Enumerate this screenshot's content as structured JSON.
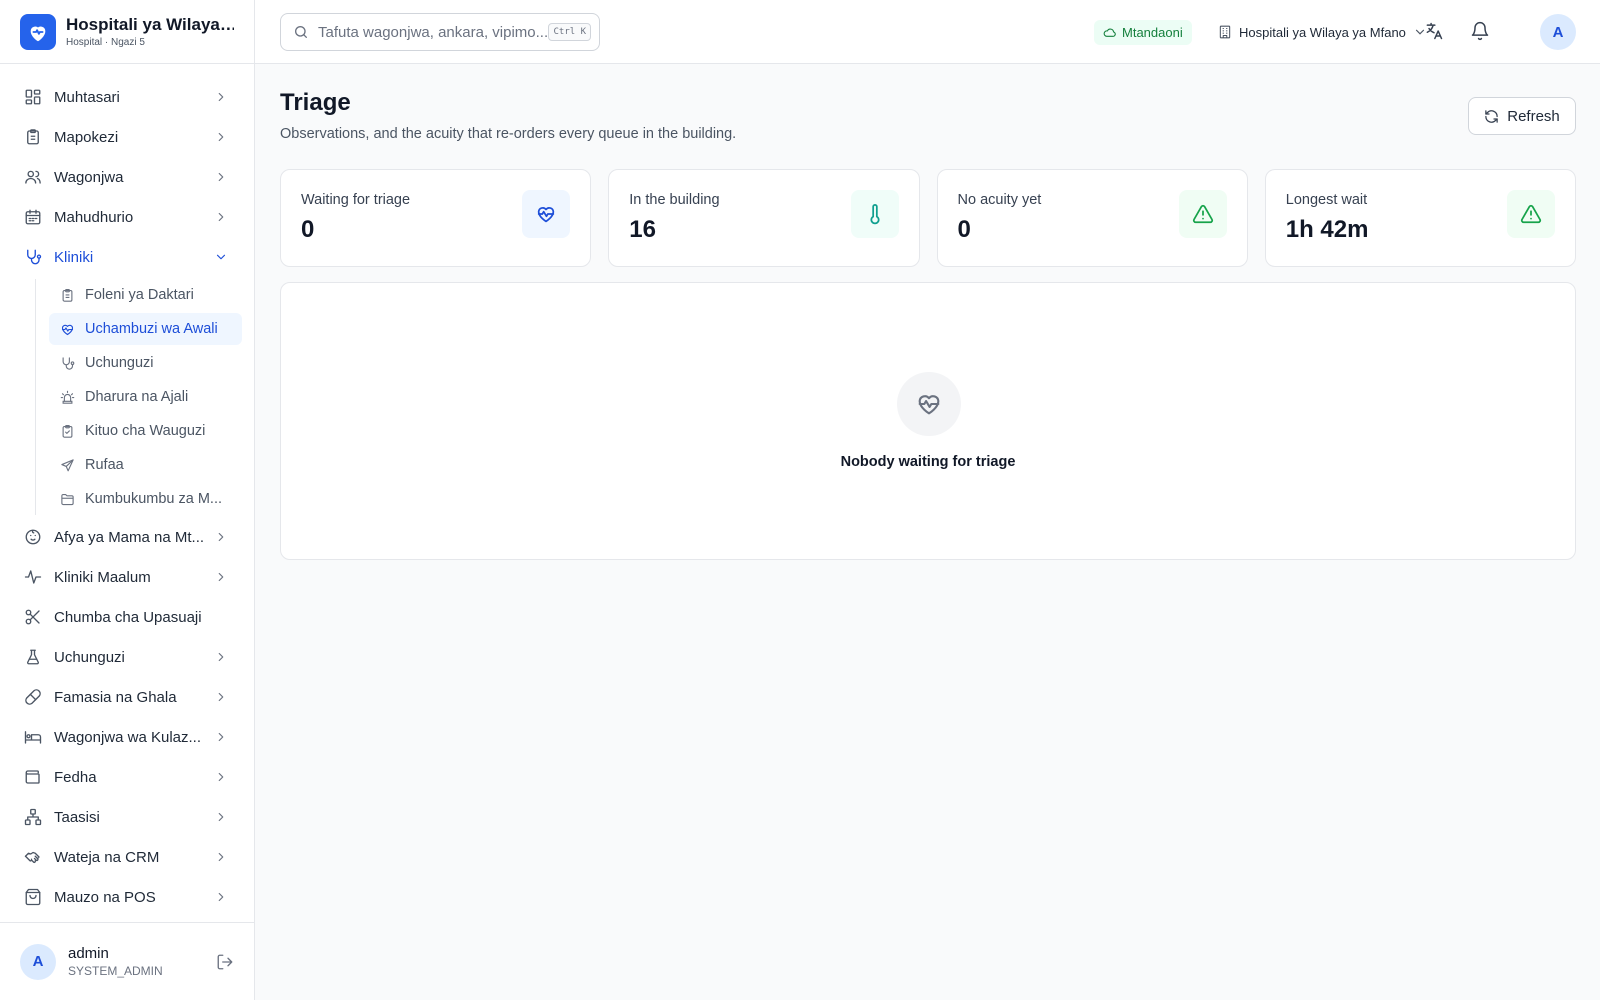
{
  "brand": {
    "name": "Hospitali ya Wilaya ...",
    "subtitle": "Hospital · Ngazi 5",
    "icon": "heart-shield-icon"
  },
  "sidebar": {
    "items": [
      {
        "label": "Muhtasari",
        "icon": "dashboard-icon"
      },
      {
        "label": "Mapokezi",
        "icon": "clipboard-icon"
      },
      {
        "label": "Wagonjwa",
        "icon": "users-icon"
      },
      {
        "label": "Mahudhurio",
        "icon": "calendar-icon"
      },
      {
        "label": "Kliniki",
        "icon": "stethoscope-icon",
        "expanded": true
      },
      {
        "label": "Afya ya Mama na Mt...",
        "icon": "baby-icon"
      },
      {
        "label": "Kliniki Maalum",
        "icon": "activity-icon"
      },
      {
        "label": "Chumba cha Upasuaji",
        "icon": "scissors-icon"
      },
      {
        "label": "Uchunguzi",
        "icon": "flask-icon"
      },
      {
        "label": "Famasia na Ghala",
        "icon": "pill-icon"
      },
      {
        "label": "Wagonjwa wa Kulaz...",
        "icon": "bed-icon"
      },
      {
        "label": "Fedha",
        "icon": "wallet-icon"
      },
      {
        "label": "Taasisi",
        "icon": "org-chart-icon"
      },
      {
        "label": "Wateja na CRM",
        "icon": "handshake-icon"
      },
      {
        "label": "Mauzo na POS",
        "icon": "shopping-bag-icon"
      }
    ],
    "subitems": [
      {
        "label": "Foleni ya Daktari",
        "icon": "clipboard-icon"
      },
      {
        "label": "Uchambuzi wa Awali",
        "icon": "heart-pulse-icon",
        "active": true
      },
      {
        "label": "Uchunguzi",
        "icon": "stethoscope-icon"
      },
      {
        "label": "Dharura na Ajali",
        "icon": "siren-icon"
      },
      {
        "label": "Kituo cha Wauguzi",
        "icon": "clipboard-check-icon"
      },
      {
        "label": "Rufaa",
        "icon": "send-icon"
      },
      {
        "label": "Kumbukumbu za M...",
        "icon": "folder-icon"
      }
    ]
  },
  "user": {
    "initial": "A",
    "name": "admin",
    "role": "SYSTEM_ADMIN"
  },
  "topbar": {
    "search_placeholder": "Tafuta wagonjwa, ankara, vipimo...",
    "search_shortcut": "Ctrl K",
    "status": "Mtandaoni",
    "facility": "Hospitali ya Wilaya ya Mfano",
    "avatar_initial": "A"
  },
  "page": {
    "title": "Triage",
    "subtitle": "Observations, and the acuity that re-orders every queue in the building.",
    "refresh_label": "Refresh"
  },
  "stats": [
    {
      "label": "Waiting for triage",
      "value": "0",
      "icon": "heart-pulse-icon",
      "tint": "#eff6ff"
    },
    {
      "label": "In the building",
      "value": "16",
      "icon": "thermometer-icon",
      "tint": "#f0fdf9"
    },
    {
      "label": "No acuity yet",
      "value": "0",
      "icon": "warning-icon",
      "tint": "#f0fdf4"
    },
    {
      "label": "Longest wait",
      "value": "1h 42m",
      "icon": "warning-icon",
      "tint": "#f0fdf4"
    }
  ],
  "empty": {
    "message": "Nobody waiting for triage",
    "icon": "heart-pulse-icon"
  },
  "colors": {
    "accent": "#2563eb",
    "active_text": "#1d4ed8",
    "online_bg": "#ecfdf5",
    "online_text": "#15803d"
  }
}
